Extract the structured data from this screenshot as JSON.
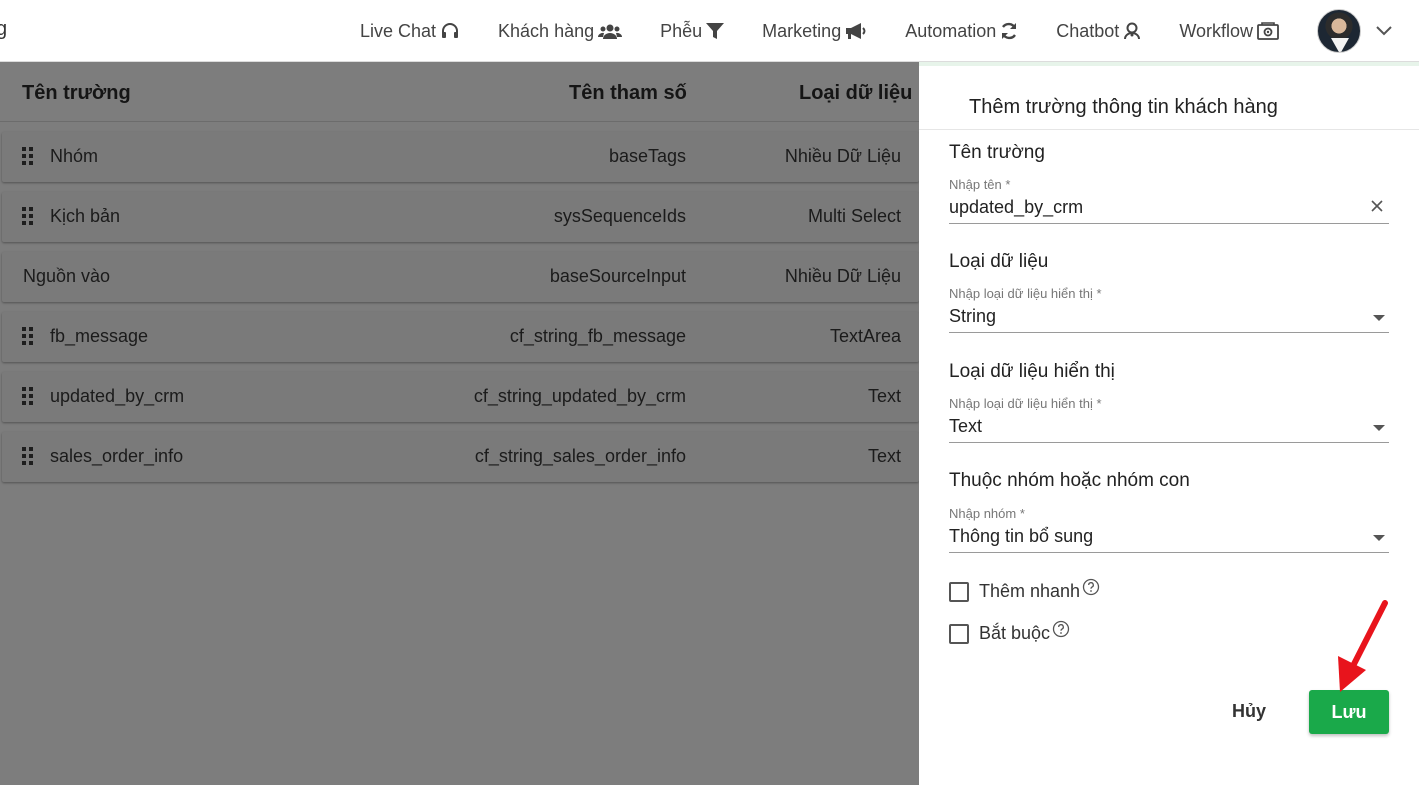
{
  "nav": {
    "brand_stub": "g",
    "items": [
      {
        "label": "Live Chat",
        "icon": "headset-icon"
      },
      {
        "label": "Khách hàng",
        "icon": "users-icon"
      },
      {
        "label": "Phễu",
        "icon": "funnel-icon"
      },
      {
        "label": "Marketing",
        "icon": "megaphone-icon"
      },
      {
        "label": "Automation",
        "icon": "sync-icon"
      },
      {
        "label": "Chatbot",
        "icon": "robot-icon"
      },
      {
        "label": "Workflow",
        "icon": "workflow-icon"
      }
    ]
  },
  "table": {
    "headers": [
      "Tên trường",
      "Tên tham số",
      "Loại dữ liệu"
    ],
    "rows": [
      {
        "name": "Nhóm",
        "param": "baseTags",
        "type": "Nhiều Dữ Liệu",
        "draggable": true
      },
      {
        "name": "Kịch bản",
        "param": "sysSequenceIds",
        "type": "Multi Select",
        "draggable": true
      },
      {
        "name": "Nguồn vào",
        "param": "baseSourceInput",
        "type": "Nhiều Dữ Liệu",
        "draggable": false
      },
      {
        "name": "fb_message",
        "param": "cf_string_fb_message",
        "type": "TextArea",
        "draggable": true
      },
      {
        "name": "updated_by_crm",
        "param": "cf_string_updated_by_crm",
        "type": "Text",
        "draggable": true
      },
      {
        "name": "sales_order_info",
        "param": "cf_string_sales_order_info",
        "type": "Text",
        "draggable": true
      }
    ]
  },
  "panel": {
    "title": "Thêm trường thông tin khách hàng",
    "field_name": {
      "label": "Tên trường",
      "hint": "Nhập tên *",
      "value": "updated_by_crm"
    },
    "data_type": {
      "label": "Loại dữ liệu",
      "hint": "Nhập loại dữ liệu hiển thị *",
      "value": "String"
    },
    "display_type": {
      "label": "Loại dữ liệu hiển thị",
      "hint": "Nhập loại dữ liệu hiển thị *",
      "value": "Text"
    },
    "group": {
      "label": "Thuộc nhóm hoặc nhóm con",
      "hint": "Nhập nhóm *",
      "value": "Thông tin bổ sung"
    },
    "quick_add": "Thêm nhanh",
    "required": "Bắt buộc",
    "cancel": "Hủy",
    "save": "Lưu"
  },
  "colors": {
    "accent": "#1aa94a",
    "overlay": "#7d7d7d",
    "annotation_arrow": "#e8141c"
  }
}
